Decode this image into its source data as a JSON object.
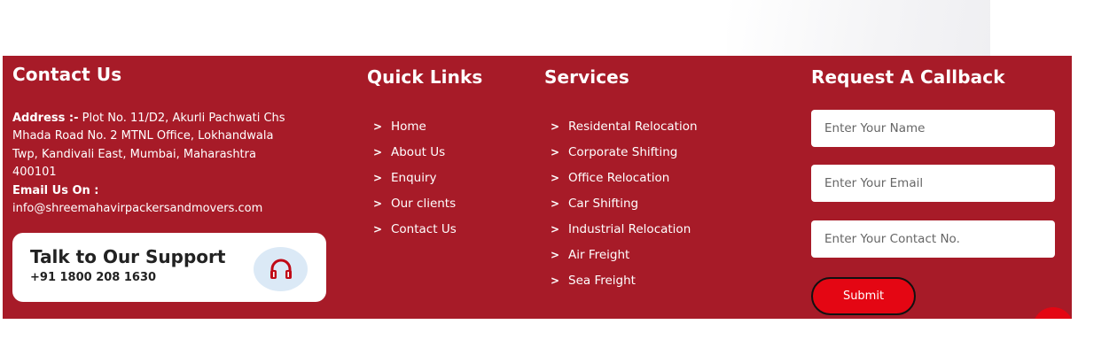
{
  "contact": {
    "heading": "Contact Us",
    "address_label": "Address :-",
    "address_text": " Plot No. 11/D2, Akurli Pachwati Chs Mhada Road No. 2 MTNL Office, Lokhandwala Twp, Kandivali East, Mumbai, Maharashtra 400101",
    "email_label": "Email Us On :",
    "email": "info@shreemahavirpackersandmovers.com"
  },
  "support": {
    "title": "Talk to Our Support",
    "phone": "+91 1800 208 1630",
    "icon": "headphones-icon"
  },
  "quick_links": {
    "heading": "Quick Links",
    "items": [
      "Home",
      "About Us",
      "Enquiry",
      "Our clients",
      "Contact Us"
    ]
  },
  "services": {
    "heading": "Services",
    "items": [
      "Residental Relocation",
      "Corporate Shifting",
      "Office Relocation",
      "Car Shifting",
      "Industrial Relocation",
      "Air Freight",
      "Sea Freight"
    ]
  },
  "callback": {
    "heading": "Request A Callback",
    "name_placeholder": "Enter Your Name",
    "email_placeholder": "Enter Your Email",
    "contact_placeholder": "Enter Your Contact No.",
    "submit_label": "Submit"
  },
  "colors": {
    "footer_bg": "#a71b28",
    "accent": "#e40613",
    "icon_bg": "#dbe9f6"
  },
  "chevron_glyph": ">"
}
